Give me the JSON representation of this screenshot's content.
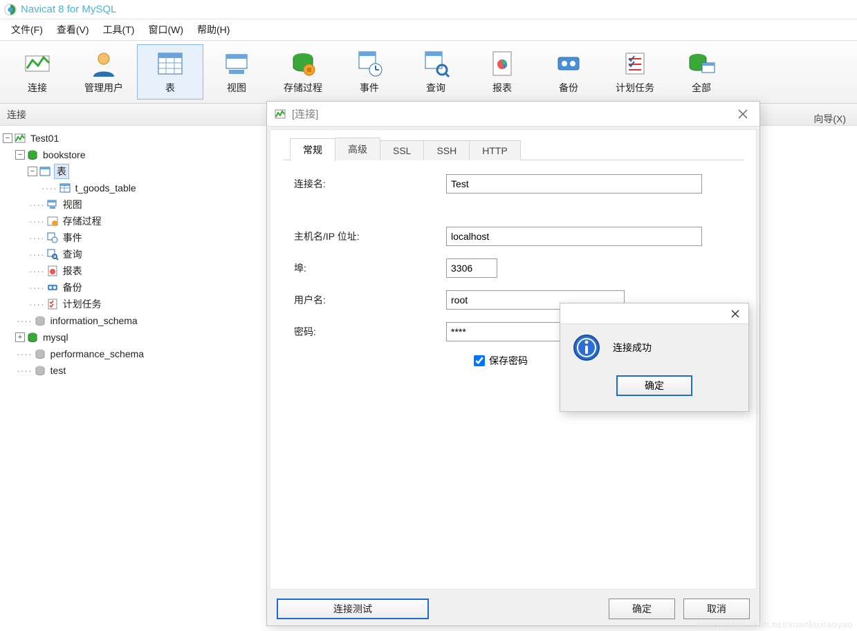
{
  "app": {
    "title": "Navicat 8 for MySQL"
  },
  "menu": {
    "file": "文件(F)",
    "view": "查看(V)",
    "tools": "工具(T)",
    "window": "窗口(W)",
    "help": "帮助(H)"
  },
  "toolbar": {
    "connect": "连接",
    "user": "管理用户",
    "table": "表",
    "view": "视图",
    "proc": "存储过程",
    "event": "事件",
    "query": "查询",
    "report": "报表",
    "backup": "备份",
    "schedule": "计划任务",
    "all": "全部"
  },
  "sidebar": {
    "title": "连接"
  },
  "rightlink": "向导(X)",
  "tree": {
    "conn": "Test01",
    "db_bookstore": "bookstore",
    "node_table": "表",
    "leaf_tgoods": "t_goods_table",
    "node_view": "视图",
    "node_proc": "存储过程",
    "node_event": "事件",
    "node_query": "查询",
    "node_report": "报表",
    "node_backup": "备份",
    "node_schedule": "计划任务",
    "db_info": "information_schema",
    "db_mysql": "mysql",
    "db_perf": "performance_schema",
    "db_test": "test"
  },
  "dialog": {
    "title": "[连接]",
    "tabs": {
      "general": "常规",
      "advanced": "高级",
      "ssl": "SSL",
      "ssh": "SSH",
      "http": "HTTP"
    },
    "labels": {
      "name": "连接名:",
      "host": "主机名/IP 位址:",
      "port": "埠:",
      "user": "用户名:",
      "pass": "密码:",
      "save": "保存密码"
    },
    "values": {
      "name": "Test",
      "host": "localhost",
      "port": "3306",
      "user": "root",
      "pass": "****"
    },
    "buttons": {
      "test": "连接测试",
      "ok": "确定",
      "cancel": "取消"
    }
  },
  "msg": {
    "text": "连接成功",
    "ok": "确定"
  },
  "watermark": "https://blog.csdn.net/xuankuxiaoyao"
}
